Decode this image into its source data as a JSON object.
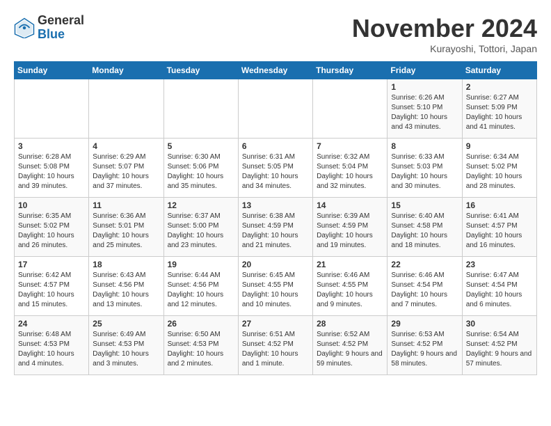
{
  "header": {
    "logo_general": "General",
    "logo_blue": "Blue",
    "month_title": "November 2024",
    "location": "Kurayoshi, Tottori, Japan"
  },
  "weekdays": [
    "Sunday",
    "Monday",
    "Tuesday",
    "Wednesday",
    "Thursday",
    "Friday",
    "Saturday"
  ],
  "weeks": [
    [
      {
        "day": "",
        "info": ""
      },
      {
        "day": "",
        "info": ""
      },
      {
        "day": "",
        "info": ""
      },
      {
        "day": "",
        "info": ""
      },
      {
        "day": "",
        "info": ""
      },
      {
        "day": "1",
        "info": "Sunrise: 6:26 AM\nSunset: 5:10 PM\nDaylight: 10 hours and 43 minutes."
      },
      {
        "day": "2",
        "info": "Sunrise: 6:27 AM\nSunset: 5:09 PM\nDaylight: 10 hours and 41 minutes."
      }
    ],
    [
      {
        "day": "3",
        "info": "Sunrise: 6:28 AM\nSunset: 5:08 PM\nDaylight: 10 hours and 39 minutes."
      },
      {
        "day": "4",
        "info": "Sunrise: 6:29 AM\nSunset: 5:07 PM\nDaylight: 10 hours and 37 minutes."
      },
      {
        "day": "5",
        "info": "Sunrise: 6:30 AM\nSunset: 5:06 PM\nDaylight: 10 hours and 35 minutes."
      },
      {
        "day": "6",
        "info": "Sunrise: 6:31 AM\nSunset: 5:05 PM\nDaylight: 10 hours and 34 minutes."
      },
      {
        "day": "7",
        "info": "Sunrise: 6:32 AM\nSunset: 5:04 PM\nDaylight: 10 hours and 32 minutes."
      },
      {
        "day": "8",
        "info": "Sunrise: 6:33 AM\nSunset: 5:03 PM\nDaylight: 10 hours and 30 minutes."
      },
      {
        "day": "9",
        "info": "Sunrise: 6:34 AM\nSunset: 5:02 PM\nDaylight: 10 hours and 28 minutes."
      }
    ],
    [
      {
        "day": "10",
        "info": "Sunrise: 6:35 AM\nSunset: 5:02 PM\nDaylight: 10 hours and 26 minutes."
      },
      {
        "day": "11",
        "info": "Sunrise: 6:36 AM\nSunset: 5:01 PM\nDaylight: 10 hours and 25 minutes."
      },
      {
        "day": "12",
        "info": "Sunrise: 6:37 AM\nSunset: 5:00 PM\nDaylight: 10 hours and 23 minutes."
      },
      {
        "day": "13",
        "info": "Sunrise: 6:38 AM\nSunset: 4:59 PM\nDaylight: 10 hours and 21 minutes."
      },
      {
        "day": "14",
        "info": "Sunrise: 6:39 AM\nSunset: 4:59 PM\nDaylight: 10 hours and 19 minutes."
      },
      {
        "day": "15",
        "info": "Sunrise: 6:40 AM\nSunset: 4:58 PM\nDaylight: 10 hours and 18 minutes."
      },
      {
        "day": "16",
        "info": "Sunrise: 6:41 AM\nSunset: 4:57 PM\nDaylight: 10 hours and 16 minutes."
      }
    ],
    [
      {
        "day": "17",
        "info": "Sunrise: 6:42 AM\nSunset: 4:57 PM\nDaylight: 10 hours and 15 minutes."
      },
      {
        "day": "18",
        "info": "Sunrise: 6:43 AM\nSunset: 4:56 PM\nDaylight: 10 hours and 13 minutes."
      },
      {
        "day": "19",
        "info": "Sunrise: 6:44 AM\nSunset: 4:56 PM\nDaylight: 10 hours and 12 minutes."
      },
      {
        "day": "20",
        "info": "Sunrise: 6:45 AM\nSunset: 4:55 PM\nDaylight: 10 hours and 10 minutes."
      },
      {
        "day": "21",
        "info": "Sunrise: 6:46 AM\nSunset: 4:55 PM\nDaylight: 10 hours and 9 minutes."
      },
      {
        "day": "22",
        "info": "Sunrise: 6:46 AM\nSunset: 4:54 PM\nDaylight: 10 hours and 7 minutes."
      },
      {
        "day": "23",
        "info": "Sunrise: 6:47 AM\nSunset: 4:54 PM\nDaylight: 10 hours and 6 minutes."
      }
    ],
    [
      {
        "day": "24",
        "info": "Sunrise: 6:48 AM\nSunset: 4:53 PM\nDaylight: 10 hours and 4 minutes."
      },
      {
        "day": "25",
        "info": "Sunrise: 6:49 AM\nSunset: 4:53 PM\nDaylight: 10 hours and 3 minutes."
      },
      {
        "day": "26",
        "info": "Sunrise: 6:50 AM\nSunset: 4:53 PM\nDaylight: 10 hours and 2 minutes."
      },
      {
        "day": "27",
        "info": "Sunrise: 6:51 AM\nSunset: 4:52 PM\nDaylight: 10 hours and 1 minute."
      },
      {
        "day": "28",
        "info": "Sunrise: 6:52 AM\nSunset: 4:52 PM\nDaylight: 9 hours and 59 minutes."
      },
      {
        "day": "29",
        "info": "Sunrise: 6:53 AM\nSunset: 4:52 PM\nDaylight: 9 hours and 58 minutes."
      },
      {
        "day": "30",
        "info": "Sunrise: 6:54 AM\nSunset: 4:52 PM\nDaylight: 9 hours and 57 minutes."
      }
    ]
  ]
}
